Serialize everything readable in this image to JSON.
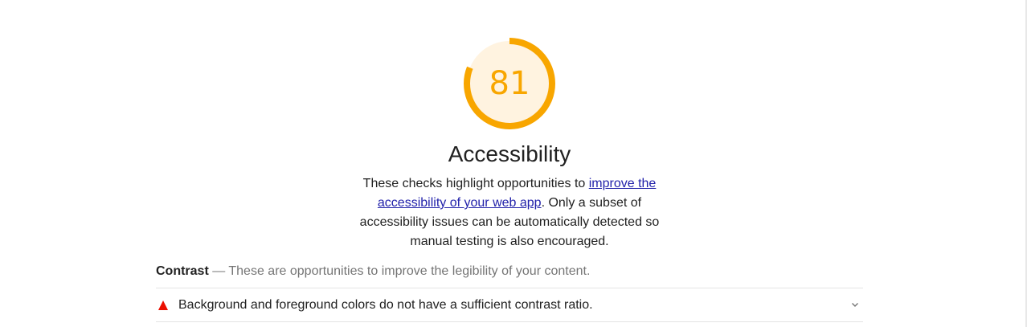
{
  "score": {
    "value": "81",
    "fraction": 0.81,
    "color": "#f8a600",
    "track_color": "#fff3e0"
  },
  "category": {
    "title": "Accessibility",
    "description_before": "These checks highlight opportunities to ",
    "description_link": "improve the accessibility of your web app",
    "description_after": ". Only a subset of accessibility issues can be automatically detected so manual testing is also encouraged."
  },
  "group": {
    "title": "Contrast",
    "description": " — These are opportunities to improve the legibility of your content."
  },
  "audits": [
    {
      "status": "fail",
      "status_color": "#eb0f00",
      "title": "Background and foreground colors do not have a sufficient contrast ratio."
    }
  ],
  "icons": {
    "fail": "warning-triangle-icon",
    "expand": "chevron-down-icon"
  }
}
